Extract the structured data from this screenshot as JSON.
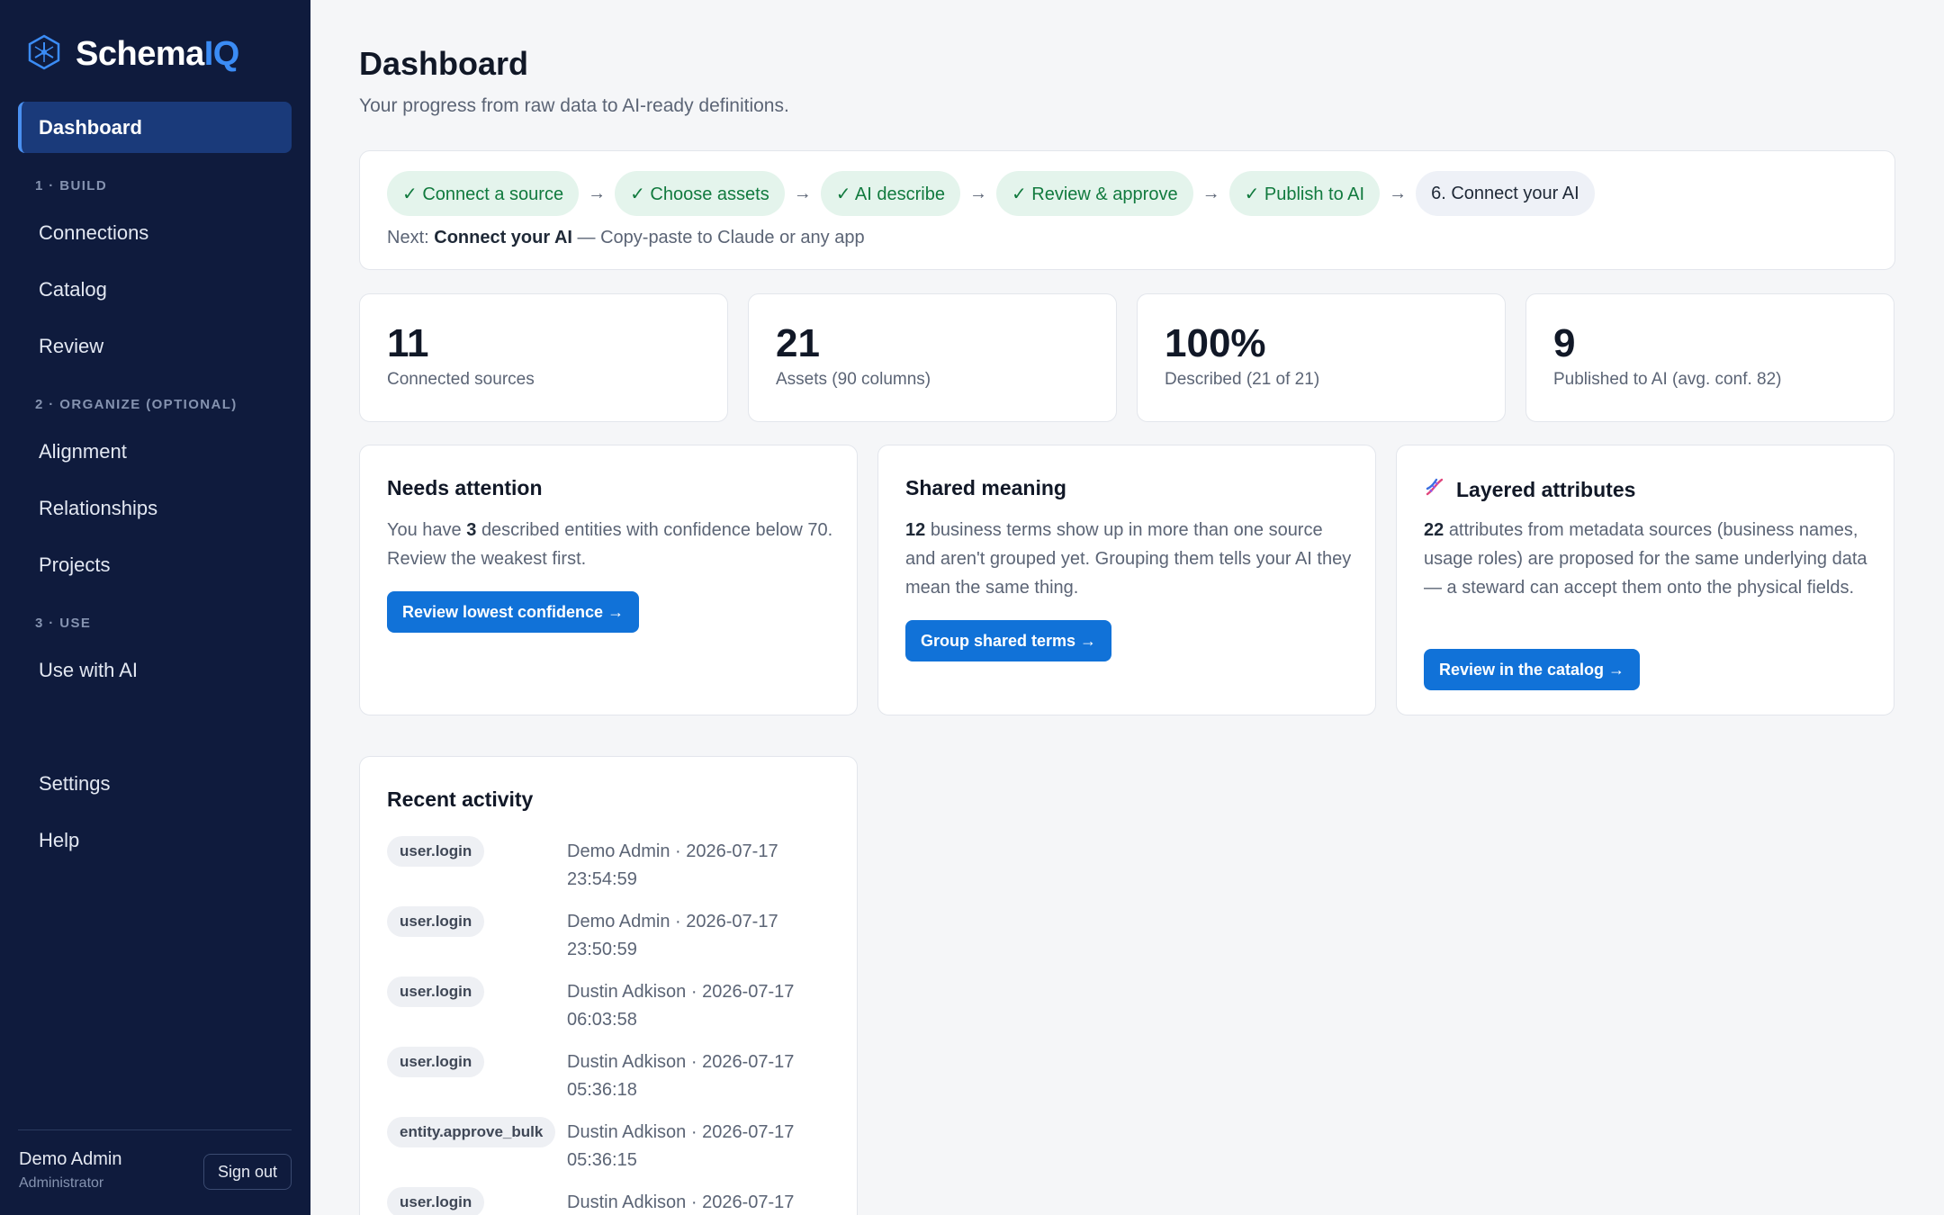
{
  "brand": {
    "name_main": "Schema",
    "name_accent": "IQ",
    "icon": "hexagon-logo-icon",
    "accent_color": "#3b8cf5"
  },
  "sidebar": {
    "active_item": "Dashboard",
    "sections": [
      {
        "label": "1 · BUILD",
        "items": [
          "Connections",
          "Catalog",
          "Review"
        ]
      },
      {
        "label": "2 · ORGANIZE (OPTIONAL)",
        "items": [
          "Alignment",
          "Relationships",
          "Projects"
        ]
      },
      {
        "label": "3 · USE",
        "items": [
          "Use with AI"
        ]
      }
    ],
    "footer_items": [
      "Settings",
      "Help"
    ],
    "user": {
      "name": "Demo Admin",
      "role": "Administrator",
      "sign_out": "Sign out"
    }
  },
  "header": {
    "title": "Dashboard",
    "subtitle": "Your progress from raw data to AI-ready definitions."
  },
  "progress": {
    "steps": [
      {
        "label": "✓ Connect a source",
        "status": "done"
      },
      {
        "label": "✓ Choose assets",
        "status": "done"
      },
      {
        "label": "✓ AI describe",
        "status": "done"
      },
      {
        "label": "✓ Review & approve",
        "status": "done"
      },
      {
        "label": "✓ Publish to AI",
        "status": "done"
      },
      {
        "label": "6. Connect your AI",
        "status": "next"
      }
    ],
    "arrow": "→",
    "next_prefix": "Next:",
    "next_step": "Connect your AI",
    "next_suffix": "— Copy-paste to Claude or any app"
  },
  "stats": [
    {
      "value": "11",
      "label": "Connected sources"
    },
    {
      "value": "21",
      "label": "Assets (90 columns)"
    },
    {
      "value": "100%",
      "label": "Described (21 of 21)"
    },
    {
      "value": "9",
      "label": "Published to AI (avg. conf. 82)"
    }
  ],
  "cards": {
    "attention": {
      "title": "Needs attention",
      "text_before": "You have",
      "count": "3",
      "text_after": "described entities with confidence below 70. Review the weakest first.",
      "button": "Review lowest confidence →"
    },
    "shared": {
      "title": "Shared meaning",
      "count": "12",
      "text_after": "business terms show up in more than one source and aren't grouped yet. Grouping them tells your AI they mean the same thing.",
      "button": "Group shared terms →"
    },
    "layered": {
      "title": "Layered attributes",
      "icon": "dna-icon",
      "count": "22",
      "text_after": "attributes from metadata sources (business names, usage roles) are proposed for the same underlying data — a steward can accept them onto the physical fields.",
      "button": "Review in the catalog →"
    }
  },
  "activity": {
    "title": "Recent activity",
    "rows": [
      {
        "event": "user.login",
        "meta": "Demo Admin · 2026-07-17 23:54:59"
      },
      {
        "event": "user.login",
        "meta": "Demo Admin · 2026-07-17 23:50:59"
      },
      {
        "event": "user.login",
        "meta": "Dustin Adkison · 2026-07-17 06:03:58"
      },
      {
        "event": "user.login",
        "meta": "Dustin Adkison · 2026-07-17 05:36:18"
      },
      {
        "event": "entity.approve_bulk",
        "meta": "Dustin Adkison · 2026-07-17 05:36:15"
      },
      {
        "event": "user.login",
        "meta": "Dustin Adkison · 2026-07-17"
      }
    ]
  },
  "colors": {
    "sidebar_bg": "#0f1b3d",
    "primary": "#1172d8",
    "done_step_bg": "#e4f4ec",
    "done_step_text": "#117a3e"
  }
}
